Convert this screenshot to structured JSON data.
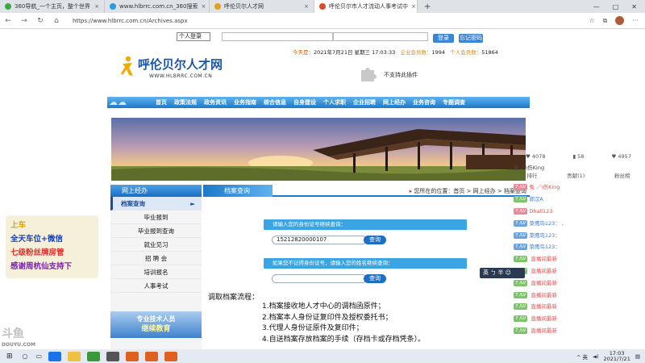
{
  "browser": {
    "tabs": [
      {
        "title": "360导航_一个主页，整个世界",
        "color": "#3aa845",
        "active": false
      },
      {
        "title": "www.hlbrrc.com.cn_360搜索",
        "color": "#2b9be0",
        "active": false
      },
      {
        "title": "呼伦贝尔人才网",
        "color": "#e0a020",
        "active": false
      },
      {
        "title": "呼伦贝尔市人才流动人事考试中",
        "color": "#d94a2a",
        "active": true
      }
    ],
    "close_glyph": "×",
    "new_tab": "+",
    "window_controls": [
      "—",
      "□",
      "✕"
    ],
    "nav": [
      "←",
      "→",
      "↻",
      "⌂"
    ],
    "url": "https://www.hlbrrc.com.cn/Archives.aspx"
  },
  "site": {
    "login": {
      "select_value": "个人登录",
      "user_placeholder": "",
      "pass_placeholder": "",
      "login_button": "登录",
      "forgot_button": "忘记密码"
    },
    "logo_title": "呼伦贝尔人才网",
    "logo_url": "WWW.HLBRRC.COM.CN",
    "info": {
      "today_label": "今天是：",
      "date": "2021年7月21日 星期三 17:03:33",
      "company_label": "企业会员数：",
      "company_count": "1994",
      "person_label": "个人会员数：",
      "person_count": "51864"
    },
    "plugin_text": "不支持此插件",
    "nav_items": [
      "首页",
      "政策法规",
      "政务资讯",
      "业务指南",
      "综合信息",
      "自身建设",
      "个人求职",
      "企业招聘",
      "网上经办",
      "业务咨询",
      "专题调查"
    ],
    "left_nav": {
      "title": "网上经办",
      "items": [
        "档案查询",
        "毕业报到",
        "毕业报到查询",
        "就业见习",
        "招 聘 会",
        "培训报名",
        "人事考试"
      ],
      "active_arrow": "►",
      "ad_line1": "专业技术人员",
      "ad_line2": "继续教育"
    },
    "main": {
      "tab_title": "档案查询",
      "breadcrumb": "您所在的位置：首页 > 网上经办 > 档案查询",
      "query1_label": "请输入您的身份证号继续查询：",
      "query1_value": "15212820000107",
      "query1_button": "查询",
      "query2_label": "如果您不记得身份证号，请输入您的姓名继续查询：",
      "query2_value": "",
      "query2_button": "查询",
      "flow_title": "调取档案流程：",
      "flow_steps": [
        "1.档案接收地人才中心的调档函原件；",
        "2.档案本人身份证复印件及授权委托书；",
        "3.代理人身份证原件及复印件；",
        "4.自送档案存放档案的手续（存档卡或存档凭条）。"
      ]
    }
  },
  "stream": {
    "stats": [
      "♥ 4078",
      "▮ 58",
      "♥ 4957"
    ],
    "top_user": "兔 ／\\伤King",
    "chat_tabs": [
      "排行",
      "贡献(1)",
      "粉丝榜"
    ],
    "messages": [
      {
        "badge": "7 /LV",
        "badge_color": "pink",
        "name": "兔 ／\\伤King",
        "text": "",
        "name_color": "red"
      },
      {
        "badge": "7 /LV",
        "badge_color": "green",
        "name": "郭汉A",
        "text": "",
        "name_color": "blue"
      },
      {
        "badge": "7 /LV",
        "badge_color": "pink",
        "name": "Dhall123",
        "text": "",
        "name_color": "red"
      },
      {
        "badge": "7 /LV",
        "badge_color": "blue",
        "name": "菜鹰鸟123：",
        "text": "。",
        "name_color": "blue"
      },
      {
        "badge": "7 /LV",
        "badge_color": "blue",
        "name": "菜鹰鸟123：",
        "text": "",
        "name_color": "blue"
      },
      {
        "badge": "7 /LV",
        "badge_color": "blue",
        "name": "菜鹰鸟123：",
        "text": "",
        "name_color": "blue"
      },
      {
        "badge": "7 /LV",
        "badge_color": "green",
        "name": "",
        "text": "直播间最新",
        "name_color": "blue"
      },
      {
        "badge": "7 /LV",
        "badge_color": "green",
        "name": "",
        "text": "直播间最新",
        "name_color": "blue"
      },
      {
        "badge": "7 /LV",
        "badge_color": "green",
        "name": "",
        "text": "直播间最新",
        "name_color": "blue"
      },
      {
        "badge": "7 /LV",
        "badge_color": "green",
        "name": "",
        "text": "直播间最新",
        "name_color": "blue"
      },
      {
        "badge": "7 /LV",
        "badge_color": "green",
        "name": "",
        "text": "直播间最新",
        "name_color": "blue"
      },
      {
        "badge": "7 /LV",
        "badge_color": "green",
        "name": "",
        "text": "直播间最新",
        "name_color": "blue"
      },
      {
        "badge": "7 /LV",
        "badge_color": "green",
        "name": "",
        "text": "直播间最新",
        "name_color": "blue"
      }
    ],
    "overlay_lines": [
      "上车",
      "全天车位+微信",
      "七级粉丝牌房管",
      "感谢周杭仙支持下"
    ],
    "watermark": "斗鱼",
    "watermark_sub": "DOUYU.COM",
    "ime": "英 ㄅ 半 ☺"
  },
  "taskbar": {
    "icons": [
      "#1a73e8",
      "#3a3a3a",
      "#e8a020",
      "#3a9a3a",
      "#e06020",
      "#e06020",
      "#e06020"
    ],
    "tray_text": "^ 英",
    "time": "17:03",
    "date": "2021/7/21"
  },
  "colors": {
    "accent_blue": "#1d79c9",
    "logo_blue": "#1b56a8",
    "today_orange": "#e05a00"
  }
}
